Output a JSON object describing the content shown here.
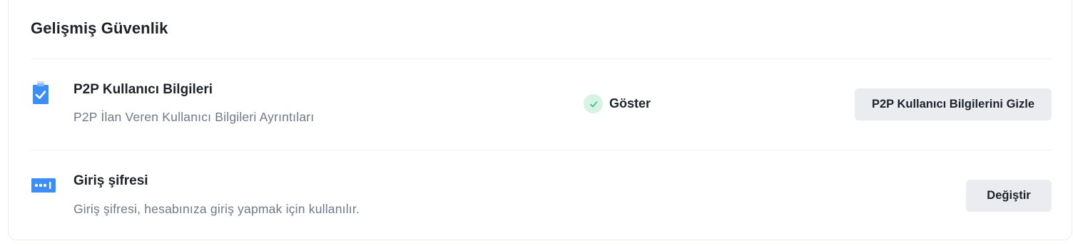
{
  "section": {
    "title": "Gelişmiş Güvenlik"
  },
  "rows": [
    {
      "icon": "clipboard-check-icon",
      "title": "P2P Kullanıcı Bilgileri",
      "description": "P2P İlan Veren Kullanıcı Bilgileri Ayrıntıları",
      "status": "Göster",
      "action_label": "P2P Kullanıcı Bilgilerini Gizle"
    },
    {
      "icon": "password-icon",
      "title": "Giriş şifresi",
      "description": "Giriş şifresi, hesabınıza giriş yapmak için kullanılır.",
      "action_label": "Değiştir"
    }
  ],
  "colors": {
    "accent_blue": "#3b8ef5",
    "status_green": "#2ebd85",
    "status_green_bg": "#d7f3e4",
    "button_bg": "#eaecef",
    "text_primary": "#1e2329",
    "text_secondary": "#707a8a"
  }
}
